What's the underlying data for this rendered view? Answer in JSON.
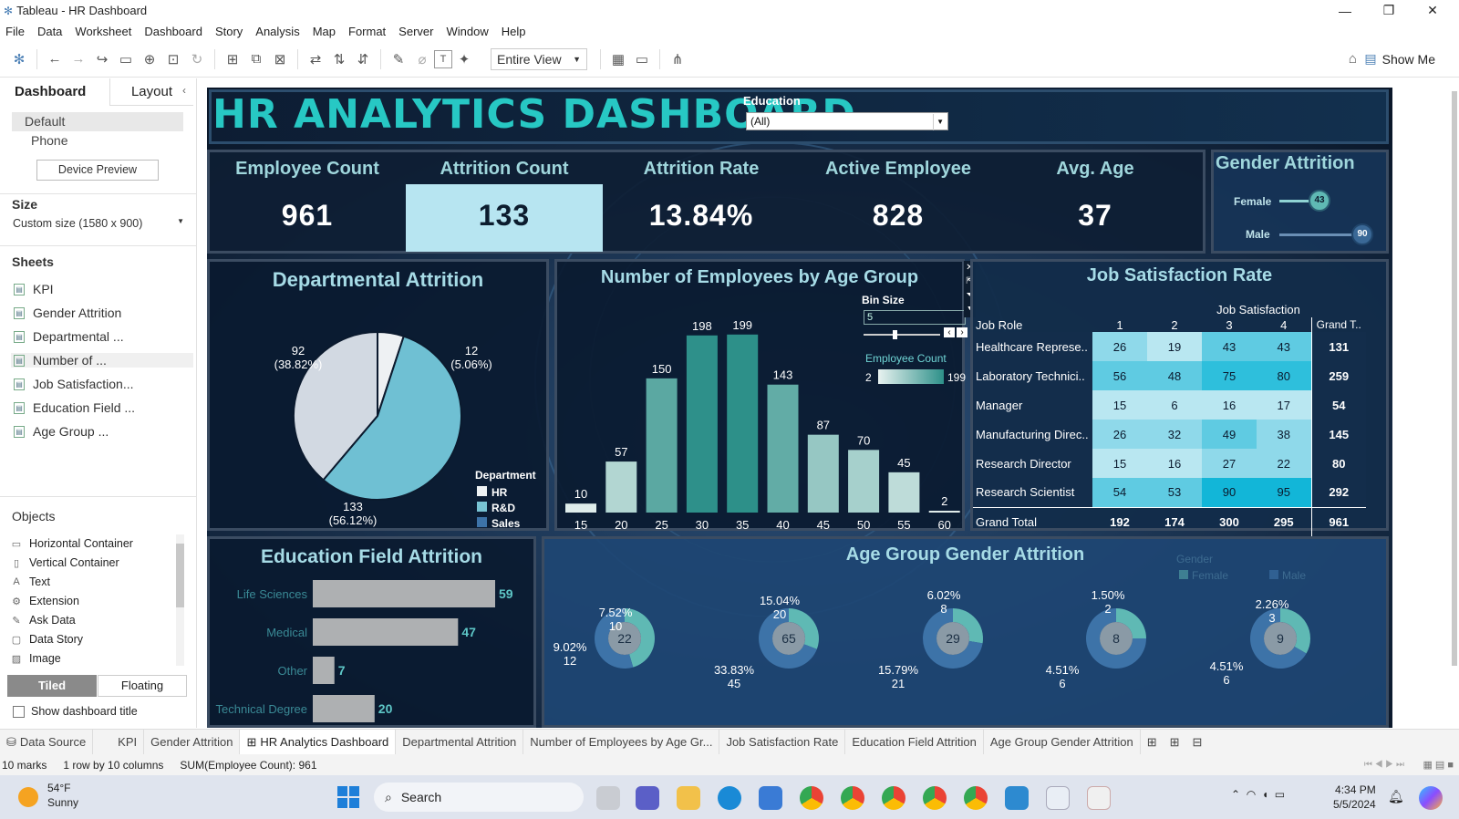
{
  "window": {
    "title": "Tableau - HR Dashboard"
  },
  "menu": [
    "File",
    "Data",
    "Worksheet",
    "Dashboard",
    "Story",
    "Analysis",
    "Map",
    "Format",
    "Server",
    "Window",
    "Help"
  ],
  "toolbar": {
    "view": "Entire View",
    "show_me": "Show Me"
  },
  "left": {
    "tab_dashboard": "Dashboard",
    "tab_layout": "Layout",
    "default": "Default",
    "phone": "Phone",
    "device_preview": "Device Preview",
    "size_label": "Size",
    "size_value": "Custom size (1580 x 900)",
    "sheets_label": "Sheets",
    "sheets": [
      "KPI",
      "Gender Attrition",
      "Departmental ...",
      "Number of ...",
      "Job Satisfaction...",
      "Education Field ...",
      "Age Group ..."
    ],
    "objects_label": "Objects",
    "objects": [
      "Horizontal Container",
      "Vertical Container",
      "Text",
      "Extension",
      "Ask Data",
      "Data Story",
      "Image"
    ],
    "tiled": "Tiled",
    "floating": "Floating",
    "show_title": "Show dashboard title"
  },
  "dash": {
    "title": "HR ANALYTICS DASHBOARD",
    "education_label": "Education",
    "education_value": "(All)",
    "kpis": [
      {
        "label": "Employee Count",
        "value": "961"
      },
      {
        "label": "Attrition Count",
        "value": "133"
      },
      {
        "label": "Attrition Rate",
        "value": "13.84%"
      },
      {
        "label": "Active Employee",
        "value": "828"
      },
      {
        "label": "Avg. Age",
        "value": "37"
      }
    ],
    "gender": {
      "title": "Gender Attrition",
      "female_label": "Female",
      "female": "43",
      "male_label": "Male",
      "male": "90"
    },
    "dept": {
      "title": "Departmental Attrition",
      "legend_title": "Department",
      "legend": [
        "HR",
        "R&D",
        "Sales"
      ],
      "l1a": "92",
      "l1b": "(38.82%)",
      "l2a": "12",
      "l2b": "(5.06%)",
      "l3a": "133",
      "l3b": "(56.12%)"
    },
    "age": {
      "title": "Number of Employees by Age Group",
      "bin_label": "Bin Size",
      "bin_value": "5",
      "legend_title": "Employee Count",
      "legend_min": "2",
      "legend_max": "199"
    },
    "job": {
      "title": "Job Satisfaction Rate",
      "header": "Job Satisfaction",
      "col_role": "Job Role",
      "cols": [
        "1",
        "2",
        "3",
        "4",
        "Grand T.."
      ],
      "rows": [
        {
          "role": "Healthcare Represe..",
          "v": [
            "26",
            "19",
            "43",
            "43",
            "131"
          ]
        },
        {
          "role": "Laboratory Technici..",
          "v": [
            "56",
            "48",
            "75",
            "80",
            "259"
          ]
        },
        {
          "role": "Manager",
          "v": [
            "15",
            "6",
            "16",
            "17",
            "54"
          ]
        },
        {
          "role": "Manufacturing Direc..",
          "v": [
            "26",
            "32",
            "49",
            "38",
            "145"
          ]
        },
        {
          "role": "Research Director",
          "v": [
            "15",
            "16",
            "27",
            "22",
            "80"
          ]
        },
        {
          "role": "Research Scientist",
          "v": [
            "54",
            "53",
            "90",
            "95",
            "292"
          ]
        }
      ],
      "total": {
        "role": "Grand Total",
        "v": [
          "192",
          "174",
          "300",
          "295",
          "961"
        ]
      }
    },
    "edu": {
      "title": "Education Field Attrition",
      "rows": [
        {
          "label": "Life Sciences",
          "value": "59"
        },
        {
          "label": "Medical",
          "value": "47"
        },
        {
          "label": "Other",
          "value": "7"
        },
        {
          "label": "Technical Degree",
          "value": "20"
        }
      ]
    },
    "agg": {
      "title": "Age Group Gender Attrition",
      "legend_title": "Gender",
      "legend": [
        "Female",
        "Male"
      ],
      "donuts": [
        {
          "center": "22",
          "a": "7.52%",
          "b": "10",
          "c": "9.02%",
          "d": "12"
        },
        {
          "center": "65",
          "a": "15.04%",
          "b": "20",
          "c": "33.83%",
          "d": "45"
        },
        {
          "center": "29",
          "a": "6.02%",
          "b": "8",
          "c": "15.79%",
          "d": "21"
        },
        {
          "center": "8",
          "a": "1.50%",
          "b": "2",
          "c": "4.51%",
          "d": "6"
        },
        {
          "center": "9",
          "a": "2.26%",
          "b": "3",
          "c": "4.51%",
          "d": "6"
        }
      ]
    }
  },
  "chart_data": [
    {
      "type": "pie",
      "title": "Departmental Attrition",
      "categories": [
        "HR",
        "R&D",
        "Sales"
      ],
      "values": [
        12,
        92,
        133
      ],
      "percent": [
        5.06,
        38.82,
        56.12
      ]
    },
    {
      "type": "bar",
      "title": "Number of Employees by Age Group",
      "categories": [
        "15",
        "20",
        "25",
        "30",
        "35",
        "40",
        "45",
        "50",
        "55",
        "60"
      ],
      "values": [
        10,
        57,
        150,
        198,
        199,
        143,
        87,
        70,
        45,
        2
      ]
    },
    {
      "type": "bar",
      "title": "Education Field Attrition",
      "categories": [
        "Life Sciences",
        "Medical",
        "Other",
        "Technical Degree"
      ],
      "values": [
        59,
        47,
        7,
        20
      ]
    }
  ],
  "tabs": [
    "Data Source",
    "KPI",
    "Gender Attrition",
    "HR Analytics Dashboard",
    "Departmental Attrition",
    "Number of Employees by Age Gr...",
    "Job Satisfaction Rate",
    "Education Field Attrition",
    "Age Group Gender Attrition"
  ],
  "status": {
    "marks": "10 marks",
    "layout": "1 row by 10 columns",
    "sum": "SUM(Employee Count): 961"
  },
  "taskbar": {
    "temp": "54°F",
    "weather": "Sunny",
    "search": "Search",
    "time": "4:34 PM",
    "date": "5/5/2024"
  }
}
